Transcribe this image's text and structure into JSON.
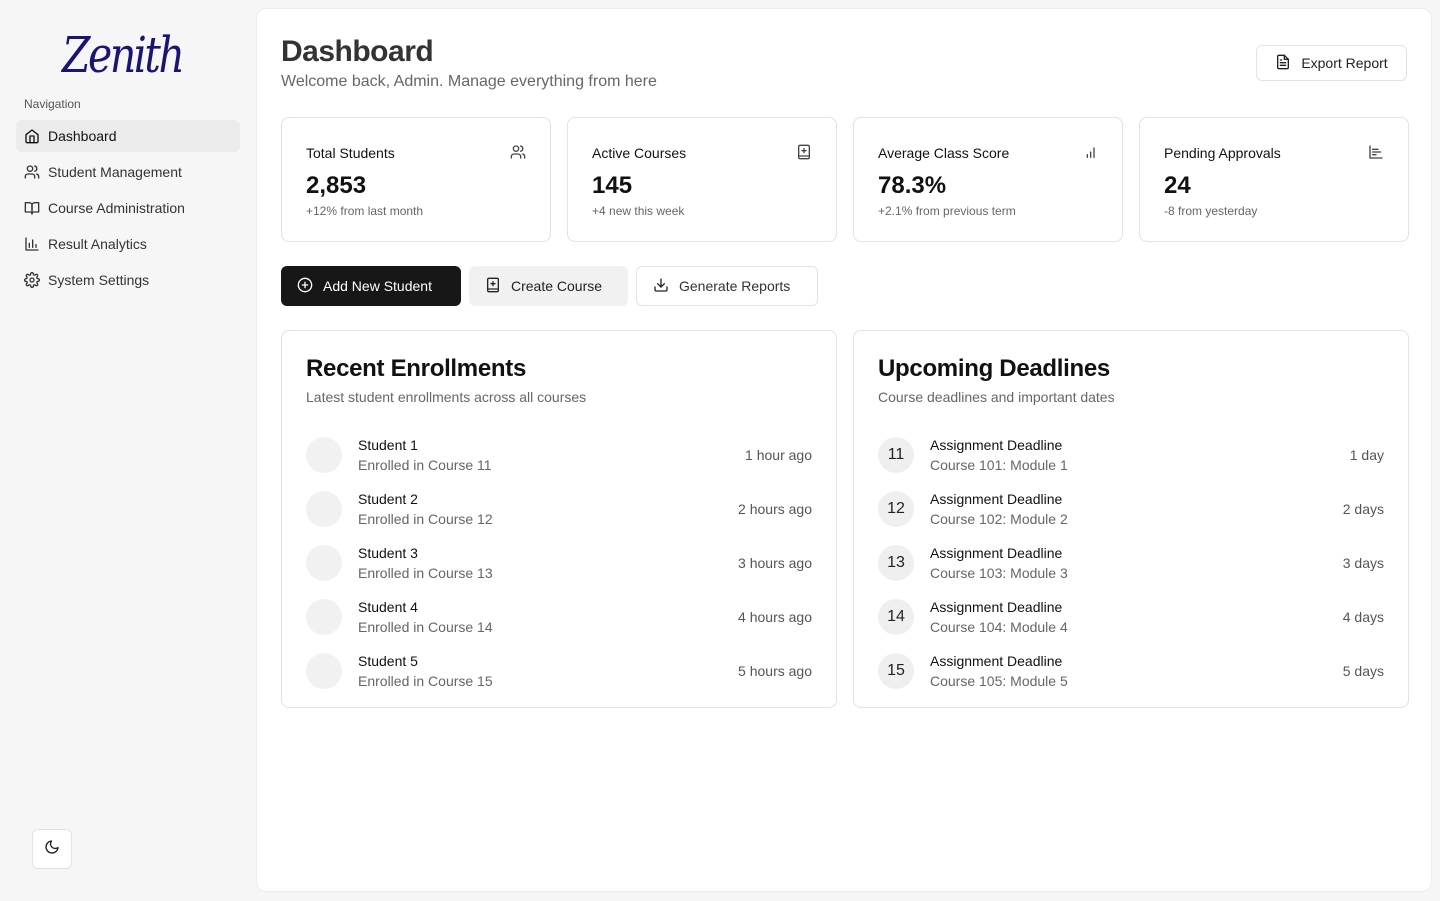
{
  "sidebar": {
    "logo": "Zenith",
    "nav_heading": "Navigation",
    "items": [
      {
        "label": "Dashboard",
        "icon": "home-icon"
      },
      {
        "label": "Student Management",
        "icon": "users-icon"
      },
      {
        "label": "Course Administration",
        "icon": "book-icon"
      },
      {
        "label": "Result Analytics",
        "icon": "bar-chart-icon"
      },
      {
        "label": "System Settings",
        "icon": "gear-icon"
      }
    ],
    "theme_toggle_icon": "moon-icon"
  },
  "header": {
    "title": "Dashboard",
    "subtitle": "Welcome back, Admin. Manage everything from here",
    "export_label": "Export Report"
  },
  "stats": [
    {
      "label": "Total Students",
      "value": "2,853",
      "change": "+12% from last month",
      "icon": "users-icon"
    },
    {
      "label": "Active Courses",
      "value": "145",
      "change": "+4 new this week",
      "icon": "book-plus-icon"
    },
    {
      "label": "Average Class Score",
      "value": "78.3%",
      "change": "+2.1% from previous term",
      "icon": "signal-bars-icon"
    },
    {
      "label": "Pending Approvals",
      "value": "24",
      "change": "-8 from yesterday",
      "icon": "bar-chart-horizontal-icon"
    }
  ],
  "actions": {
    "add_student": "Add New Student",
    "create_course": "Create Course",
    "generate_reports": "Generate Reports"
  },
  "enrollments": {
    "title": "Recent Enrollments",
    "subtitle": "Latest student enrollments across all courses",
    "items": [
      {
        "name": "Student 1",
        "detail": "Enrolled in Course 11",
        "time": "1 hour ago"
      },
      {
        "name": "Student 2",
        "detail": "Enrolled in Course 12",
        "time": "2 hours ago"
      },
      {
        "name": "Student 3",
        "detail": "Enrolled in Course 13",
        "time": "3 hours ago"
      },
      {
        "name": "Student 4",
        "detail": "Enrolled in Course 14",
        "time": "4 hours ago"
      },
      {
        "name": "Student 5",
        "detail": "Enrolled in Course 15",
        "time": "5 hours ago"
      }
    ]
  },
  "deadlines": {
    "title": "Upcoming Deadlines",
    "subtitle": "Course deadlines and important dates",
    "items": [
      {
        "day": "11",
        "title": "Assignment Deadline",
        "detail": "Course 101: Module 1",
        "due": "1 day"
      },
      {
        "day": "12",
        "title": "Assignment Deadline",
        "detail": "Course 102: Module 2",
        "due": "2 days"
      },
      {
        "day": "13",
        "title": "Assignment Deadline",
        "detail": "Course 103: Module 3",
        "due": "3 days"
      },
      {
        "day": "14",
        "title": "Assignment Deadline",
        "detail": "Course 104: Module 4",
        "due": "4 days"
      },
      {
        "day": "15",
        "title": "Assignment Deadline",
        "detail": "Course 105: Module 5",
        "due": "5 days"
      }
    ]
  }
}
